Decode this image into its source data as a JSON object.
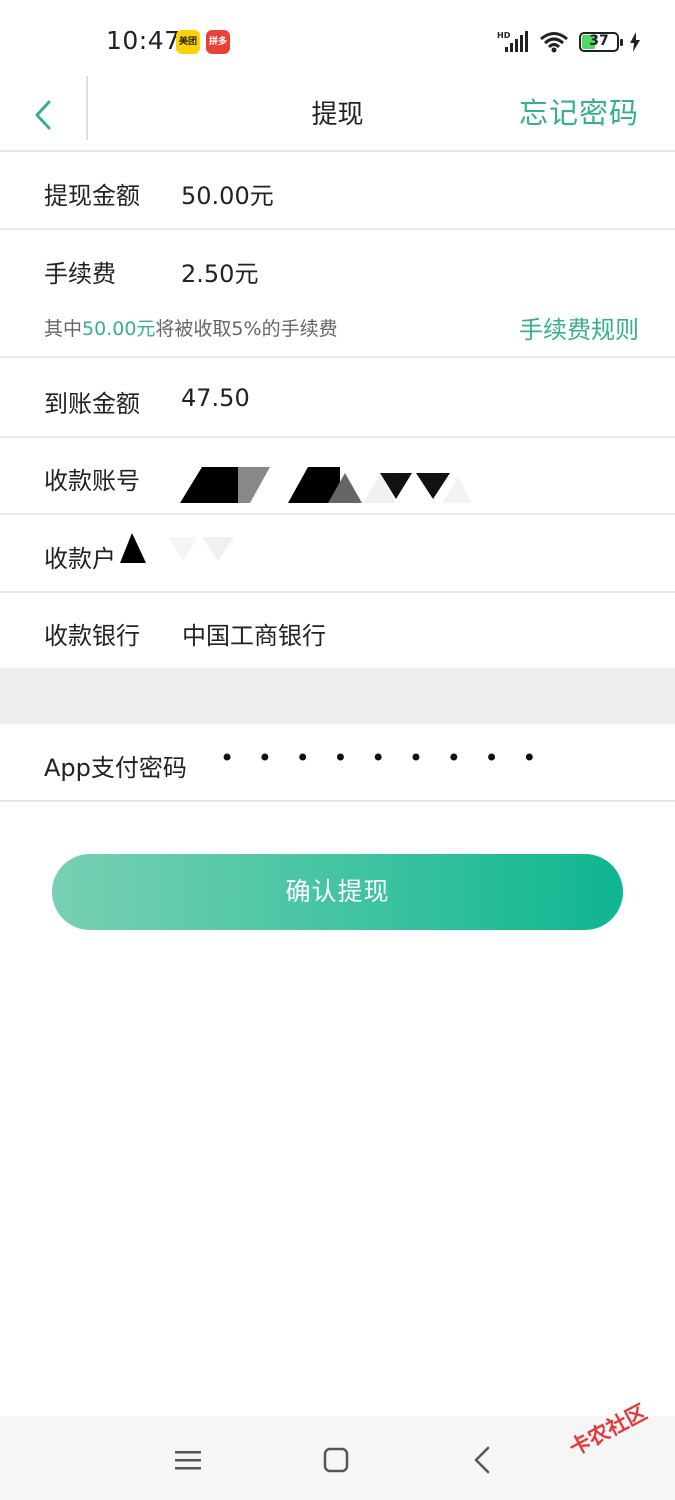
{
  "status_bar": {
    "time": "10:47",
    "app_icons": [
      "美团",
      "拼多多"
    ],
    "network_label": "HD",
    "battery_level": "37"
  },
  "nav": {
    "title": "提现",
    "right_action": "忘记密码"
  },
  "form": {
    "withdraw_amount": {
      "label": "提现金额",
      "value": "50.00元"
    },
    "fee": {
      "label": "手续费",
      "value": "2.50元",
      "note_prefix": "其中",
      "note_amount": "50.00元",
      "note_suffix": "将被收取5%的手续费",
      "rules_link": "手续费规则"
    },
    "received_amount": {
      "label": "到账金额",
      "value": "47.50"
    },
    "account_number": {
      "label": "收款账号"
    },
    "account_holder": {
      "label": "收款户"
    },
    "bank": {
      "label": "收款银行",
      "value": "中国工商银行"
    },
    "pay_password": {
      "label": "App支付密码",
      "value": "• • • • • • • • •"
    }
  },
  "confirm_button": "确认提现",
  "watermark_text": "卡农社区",
  "colors": {
    "accent": "#38B08A",
    "gap_band": "#ededed"
  }
}
